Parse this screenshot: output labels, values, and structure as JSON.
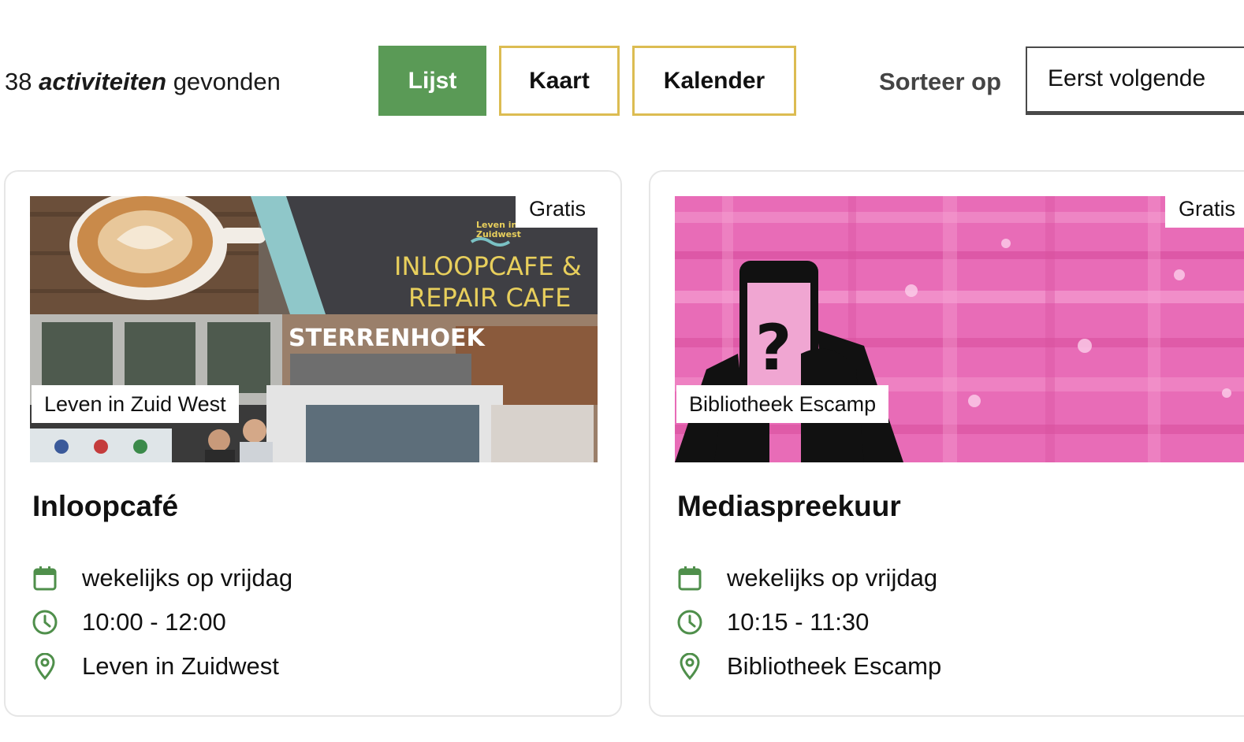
{
  "results": {
    "count": "38",
    "noun": "activiteiten",
    "suffix": "gevonden"
  },
  "view_toggle": {
    "list_label": "Lijst",
    "map_label": "Kaart",
    "calendar_label": "Kalender",
    "active": "Lijst"
  },
  "sort": {
    "label": "Sorteer op",
    "selected": "Eerst volgende"
  },
  "colors": {
    "accent_green": "#5a9a56",
    "border_gold": "#dcbc52",
    "icon_green": "#4f8f4b"
  },
  "cards": [
    {
      "title": "Inloopcafé",
      "price": "Gratis",
      "organizer": "Leven in Zuid West",
      "schedule": "wekelijks op vrijdag",
      "time": "10:00 - 12:00",
      "location": "Leven in Zuidwest",
      "image_text": {
        "banner_line1": "INLOOPCAFE &",
        "banner_line2": "REPAIR CAFE",
        "logo_line1": "Leven in",
        "logo_line2": "Zuidwest",
        "building_sign": "STERRENHOEK"
      }
    },
    {
      "title": "Mediaspreekuur",
      "price": "Gratis",
      "organizer": "Bibliotheek Escamp",
      "schedule": "wekelijks op vrijdag",
      "time": "10:15 - 11:30",
      "location": "Bibliotheek Escamp",
      "image_text": {
        "phone_symbol": "?"
      }
    }
  ],
  "icons": {
    "schedule": "calendar-icon",
    "time": "clock-icon",
    "location": "map-pin-icon"
  }
}
